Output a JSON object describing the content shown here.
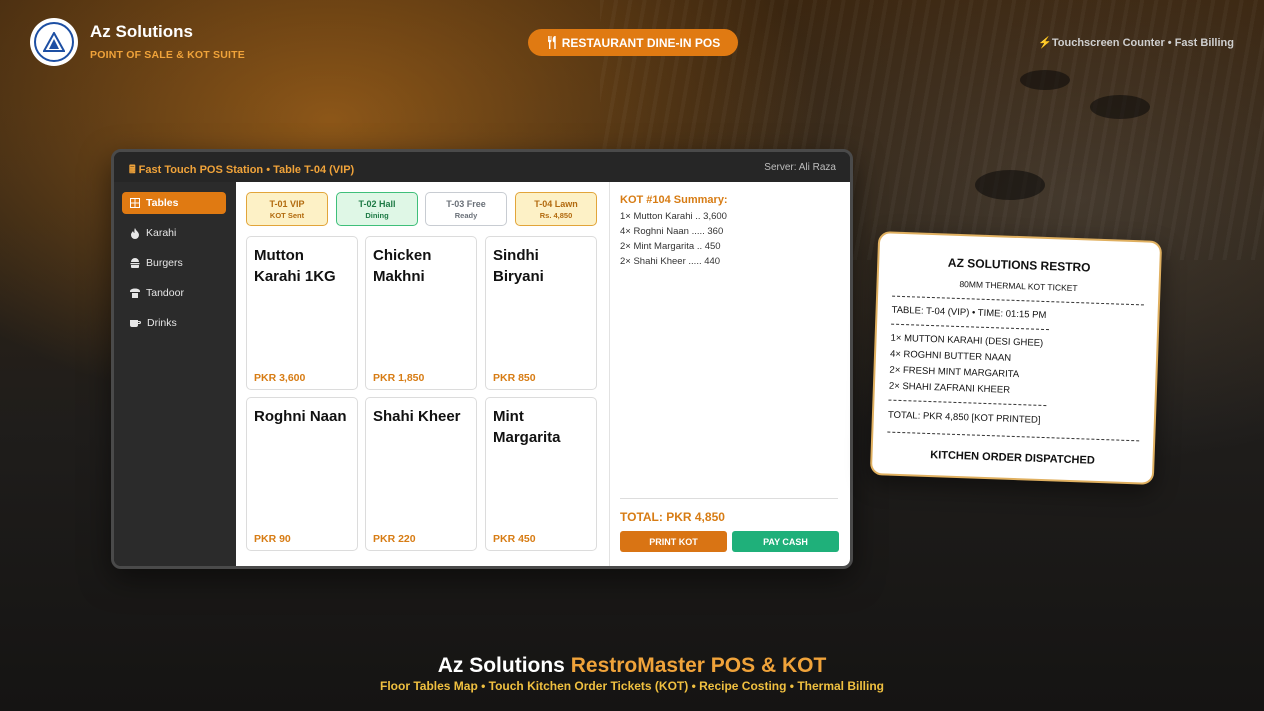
{
  "header": {
    "brand_name": "Az Solutions",
    "brand_sub": "POINT OF SALE & KOT SUITE",
    "mode_label": "RESTAURANT DINE-IN POS",
    "right_text": "Touchscreen Counter • Fast Billing"
  },
  "pos": {
    "title": "Fast Touch POS Station • Table T-04 (VIP)",
    "server": "Server: Ali Raza",
    "sidebar": [
      {
        "label": "Tables",
        "icon": "grid-icon",
        "active": true
      },
      {
        "label": "Karahi",
        "icon": "fire-icon"
      },
      {
        "label": "Burgers",
        "icon": "burger-icon"
      },
      {
        "label": "Tandoor",
        "icon": "oven-icon"
      },
      {
        "label": "Drinks",
        "icon": "cup-icon"
      }
    ],
    "tables": [
      {
        "name": "T-01 VIP",
        "status": "KOT Sent"
      },
      {
        "name": "T-02 Hall",
        "status": "Dining"
      },
      {
        "name": "T-03 Free",
        "status": "Ready"
      },
      {
        "name": "T-04 Lawn",
        "status": "Rs. 4,850"
      }
    ],
    "items": [
      {
        "name": "Mutton Karahi 1KG",
        "price": "PKR 3,600"
      },
      {
        "name": "Chicken Makhni",
        "price": "PKR 1,850"
      },
      {
        "name": "Sindhi Biryani",
        "price": "PKR 850"
      },
      {
        "name": "Roghni Naan",
        "price": "PKR 90"
      },
      {
        "name": "Shahi Kheer",
        "price": "PKR 220"
      },
      {
        "name": "Mint Margarita",
        "price": "PKR 450"
      }
    ],
    "kot": {
      "title": "KOT #104 Summary:",
      "lines": [
        "1× Mutton Karahi .. 3,600",
        "4× Roghni Naan ..... 360",
        "2× Mint Margarita .. 450",
        "2× Shahi Kheer ..... 440"
      ],
      "total": "TOTAL: PKR 4,850",
      "print_label": "PRINT KOT",
      "pay_label": "PAY CASH"
    }
  },
  "receipt": {
    "title": "AZ SOLUTIONS RESTRO",
    "subtitle": "80MM THERMAL KOT TICKET",
    "table_line": "TABLE: T-04 (VIP) • TIME: 01:15 PM",
    "items": [
      "1× MUTTON KARAHI (DESI GHEE)",
      "4× ROGHNI BUTTER NAAN",
      "2× FRESH MINT MARGARITA",
      "2× SHAHI ZAFRANI KHEER"
    ],
    "total_line": "TOTAL: PKR 4,850 [KOT PRINTED]",
    "footer": "KITCHEN ORDER DISPATCHED"
  },
  "footer": {
    "title_a": "Az Solutions",
    "title_b": "RestroMaster POS & KOT",
    "subtitle": "Floor Tables Map • Touch Kitchen Order Tickets (KOT) • Recipe Costing • Thermal Billing"
  },
  "colors": {
    "accent": "#e07a12",
    "accent_text": "#f0a33a",
    "pay_green": "#1fb07a"
  }
}
